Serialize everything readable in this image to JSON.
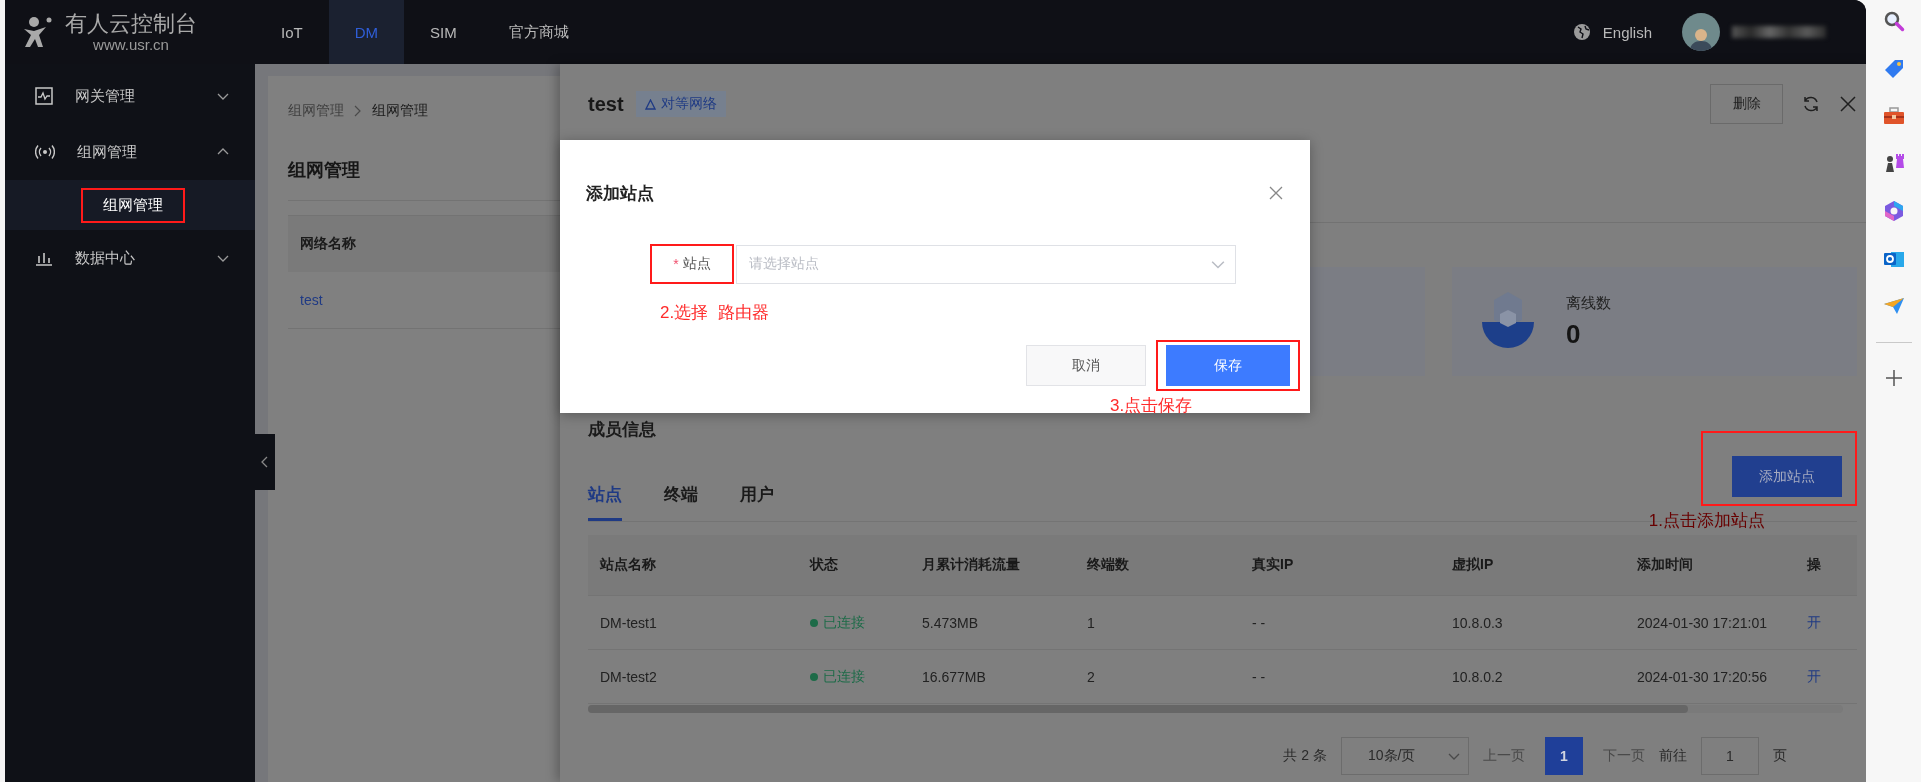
{
  "header": {
    "logo_title": "有人云控制台",
    "logo_url": "www.usr.cn",
    "nav": [
      {
        "label": "IoT",
        "selected": false
      },
      {
        "label": "DM",
        "selected": true
      },
      {
        "label": "SIM",
        "selected": false
      },
      {
        "label": "官方商城",
        "selected": false
      }
    ],
    "language": "English"
  },
  "sidebar": {
    "items": [
      {
        "label": "网关管理",
        "expanded": false
      },
      {
        "label": "组网管理",
        "expanded": true,
        "children": [
          {
            "label": "组网管理",
            "selected": true,
            "annotated": true
          }
        ]
      },
      {
        "label": "数据中心",
        "expanded": false
      }
    ]
  },
  "left_panel": {
    "breadcrumb": [
      "组网管理",
      "组网管理"
    ],
    "title": "组网管理",
    "table": {
      "columns": [
        "网络名称"
      ],
      "rows": [
        [
          "test"
        ]
      ]
    }
  },
  "drawer": {
    "title": "test",
    "tag": "对等网络",
    "delete_button": "删除",
    "stats": [
      {
        "label": "离线数",
        "value": "0"
      }
    ],
    "section_title": "成员信息",
    "tabs": [
      {
        "label": "站点",
        "selected": true
      },
      {
        "label": "终端",
        "selected": false
      },
      {
        "label": "用户",
        "selected": false
      }
    ],
    "add_button": {
      "label": "添加站点",
      "annotated": true,
      "note": "1.点击添加站点"
    },
    "table": {
      "columns": [
        "站点名称",
        "状态",
        "月累计消耗流量",
        "终端数",
        "真实IP",
        "虚拟IP",
        "添加时间",
        "操"
      ],
      "rows": [
        [
          "DM-test1",
          "已连接",
          "5.473MB",
          "1",
          "- -",
          "10.8.0.3",
          "2024-01-30 17:21:01",
          "开"
        ],
        [
          "DM-test2",
          "已连接",
          "16.677MB",
          "2",
          "- -",
          "10.8.0.2",
          "2024-01-30 17:20:56",
          "开"
        ]
      ]
    },
    "pagination": {
      "total": "共 2 条",
      "page_size": "10条/页",
      "prev": "上一页",
      "pages": [
        {
          "label": "1",
          "selected": true
        }
      ],
      "next": "下一页",
      "goto_label": "前往",
      "goto_value": "1",
      "goto_suffix": "页"
    }
  },
  "modal": {
    "title": "添加站点",
    "field": {
      "required_mark": "*",
      "label": "站点",
      "placeholder": "请选择站点",
      "annotated": true,
      "notes": [
        "2.选择",
        "路由器"
      ]
    },
    "buttons": [
      {
        "label": "取消",
        "kind": "secondary",
        "annotated": false
      },
      {
        "label": "保存",
        "kind": "primary",
        "annotated": true,
        "note": "3.点击保存"
      }
    ]
  }
}
